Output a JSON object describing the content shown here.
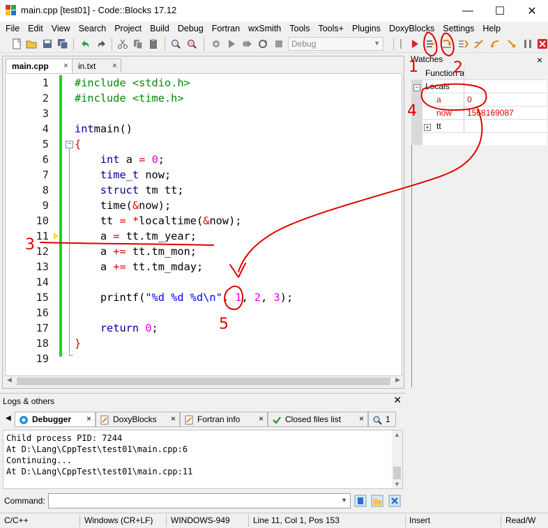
{
  "window": {
    "title": "main.cpp [test01] - Code::Blocks 17.12",
    "minimize": "—",
    "maximize": "☐",
    "close": "✕"
  },
  "menu": [
    "File",
    "Edit",
    "View",
    "Search",
    "Project",
    "Build",
    "Debug",
    "Fortran",
    "wxSmith",
    "Tools",
    "Tools+",
    "Plugins",
    "DoxyBlocks",
    "Settings",
    "Help"
  ],
  "toolbar": {
    "build_target": "Debug"
  },
  "editor": {
    "tabs": [
      {
        "label": "main.cpp",
        "close": "×"
      },
      {
        "label": "in.txt",
        "close": "×"
      }
    ],
    "line_numbers": [
      "1",
      "2",
      "3",
      "4",
      "5",
      "6",
      "7",
      "8",
      "9",
      "10",
      "11",
      "12",
      "13",
      "14",
      "15",
      "16",
      "17",
      "18",
      "19"
    ]
  },
  "watches": {
    "title": "Watches",
    "close": "×",
    "col_function": "Function a",
    "locals_label": "Locals",
    "expand_minus": "−",
    "expand_plus": "+",
    "rows": [
      {
        "name": "a",
        "value": "0"
      },
      {
        "name": "now",
        "value": "1568169087"
      },
      {
        "name": "tt",
        "value": ""
      }
    ]
  },
  "logs": {
    "title": "Logs & others",
    "close": "✕",
    "tabs": [
      {
        "label": "Debugger",
        "close": "×"
      },
      {
        "label": "DoxyBlocks",
        "close": "×"
      },
      {
        "label": "Fortran info",
        "close": "×"
      },
      {
        "label": "Closed files list",
        "close": "×"
      },
      {
        "label": "1",
        "close": ""
      }
    ],
    "lines": [
      "Child process PID: 7244",
      "At D:\\Lang\\CppTest\\test01\\main.cpp:6",
      "Continuing...",
      "At D:\\Lang\\CppTest\\test01\\main.cpp:11"
    ],
    "command_label": "Command:",
    "command_value": ""
  },
  "status": {
    "language": "C/C++",
    "line_endings": "Windows (CR+LF)",
    "encoding": "WINDOWS-949",
    "position": "Line 11, Col 1, Pos 153",
    "mode": "Insert",
    "access": "Read/W"
  },
  "annotations": {
    "n1": "1",
    "n2": "2",
    "n3": "3",
    "n4": "4",
    "n5": "5"
  },
  "colors": {
    "keyword": "#00009a",
    "preprocessor": "#008a00",
    "number": "#e000e0",
    "string": "#0000ff",
    "operator": "#e00000",
    "annotation": "#e00000",
    "change_bar": "#1fd21f"
  }
}
